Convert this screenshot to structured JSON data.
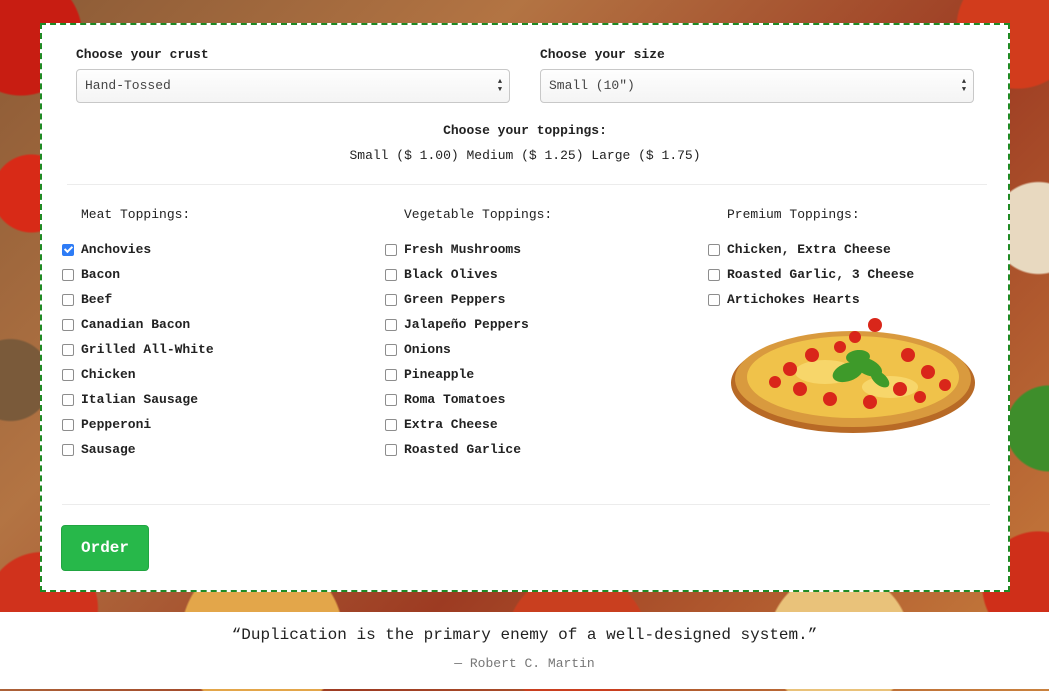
{
  "form": {
    "crust": {
      "label": "Choose your crust",
      "value": "Hand-Tossed"
    },
    "size": {
      "label": "Choose your size",
      "value": "Small (10\")"
    },
    "toppings_title": "Choose your toppings:",
    "toppings_prices": "Small ($ 1.00) Medium ($ 1.25) Large ($ 1.75)",
    "meat": {
      "title": "Meat Toppings:",
      "items": [
        {
          "label": "Anchovies",
          "checked": true
        },
        {
          "label": "Bacon",
          "checked": false
        },
        {
          "label": "Beef",
          "checked": false
        },
        {
          "label": "Canadian Bacon",
          "checked": false
        },
        {
          "label": "Grilled All-White",
          "checked": false
        },
        {
          "label": "Chicken",
          "checked": false
        },
        {
          "label": "Italian Sausage",
          "checked": false
        },
        {
          "label": "Pepperoni",
          "checked": false
        },
        {
          "label": "Sausage",
          "checked": false
        }
      ]
    },
    "vegetable": {
      "title": "Vegetable Toppings:",
      "items": [
        {
          "label": "Fresh Mushrooms",
          "checked": false
        },
        {
          "label": "Black Olives",
          "checked": false
        },
        {
          "label": "Green Peppers",
          "checked": false
        },
        {
          "label": "Jalapeño Peppers",
          "checked": false
        },
        {
          "label": "Onions",
          "checked": false
        },
        {
          "label": "Pineapple",
          "checked": false
        },
        {
          "label": "Roma Tomatoes",
          "checked": false
        },
        {
          "label": "Extra Cheese",
          "checked": false
        },
        {
          "label": "Roasted Garlice",
          "checked": false
        }
      ]
    },
    "premium": {
      "title": "Premium Toppings:",
      "items": [
        {
          "label": "Chicken, Extra Cheese",
          "checked": false
        },
        {
          "label": "Roasted Garlic, 3 Cheese",
          "checked": false
        },
        {
          "label": "Artichokes Hearts",
          "checked": false
        }
      ]
    },
    "order_label": "Order"
  },
  "quote": {
    "text": "“Duplication is the primary enemy of a well-designed system.”",
    "author": "— Robert C. Martin"
  },
  "colors": {
    "order_button": "#27b84a",
    "card_border": "#1f8a24",
    "checkbox_checked": "#2e7cf6"
  }
}
